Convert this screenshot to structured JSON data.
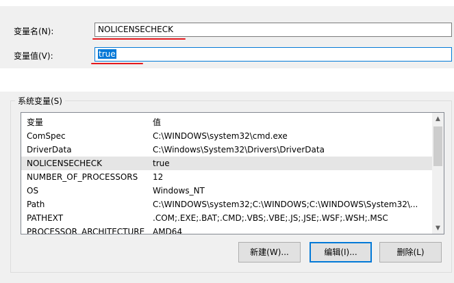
{
  "edit": {
    "name_label": "变量名(N):",
    "name_value": "NOLICENSECHECK",
    "value_label": "变量值(V):",
    "value_value": "true"
  },
  "system_vars": {
    "group_title": "系统变量(S)",
    "columns": [
      "变量",
      "值"
    ],
    "rows": [
      [
        "ComSpec",
        "C:\\WINDOWS\\system32\\cmd.exe"
      ],
      [
        "DriverData",
        "C:\\Windows\\System32\\Drivers\\DriverData"
      ],
      [
        "NOLICENSECHECK",
        "true"
      ],
      [
        "NUMBER_OF_PROCESSORS",
        "12"
      ],
      [
        "OS",
        "Windows_NT"
      ],
      [
        "Path",
        "C:\\WINDOWS\\system32;C:\\WINDOWS;C:\\WINDOWS\\System32\\..."
      ],
      [
        "PATHEXT",
        ".COM;.EXE;.BAT;.CMD;.VBS;.VBE;.JS;.JSE;.WSF;.WSH;.MSC"
      ],
      [
        "PROCESSOR_ARCHITECTURE",
        "AMD64"
      ]
    ],
    "selected_row": 2
  },
  "buttons": {
    "new": "新建(W)...",
    "edit": "编辑(I)...",
    "delete": "删除(L)"
  },
  "icons": {
    "scroll_up": "scroll-up-arrow-icon",
    "scroll_down": "scroll-down-arrow-icon"
  },
  "colors": {
    "annotation_red": "#e4171c",
    "selection_blue": "#0078d7",
    "panel_gray": "#f0f0f0"
  }
}
